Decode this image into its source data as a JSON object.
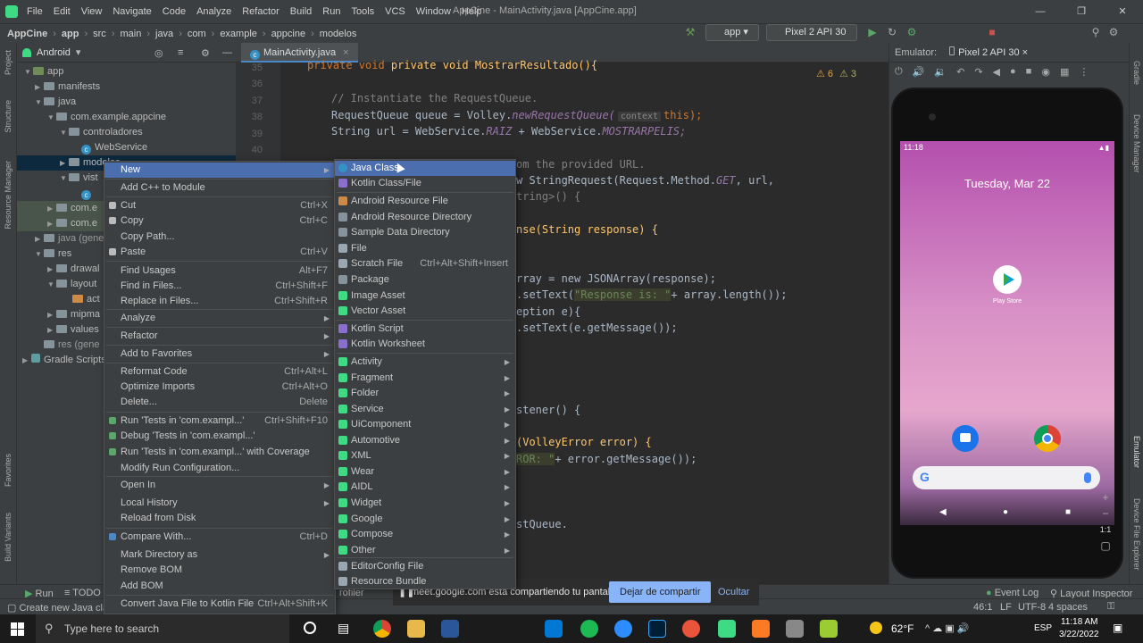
{
  "menubar": {
    "items": [
      "File",
      "Edit",
      "View",
      "Navigate",
      "Code",
      "Analyze",
      "Refactor",
      "Build",
      "Run",
      "Tools",
      "VCS",
      "Window",
      "Help"
    ],
    "title": "AppCine - MainActivity.java [AppCine.app]"
  },
  "breadcrumb": [
    "AppCine",
    "app",
    "src",
    "main",
    "java",
    "com",
    "example",
    "appcine",
    "modelos"
  ],
  "toolbar": {
    "module": "app",
    "device": "Pixel 2 API 30"
  },
  "project": {
    "view": "Android",
    "rows": [
      "app",
      "manifests",
      "java",
      "com.example.appcine",
      "controladores",
      "WebService",
      "modelos",
      "vist",
      "",
      "com.e",
      "com.e",
      "java (gene",
      "res",
      "drawal",
      "layout",
      "act",
      "mipma",
      "values",
      "res (gene",
      "Gradle Scripts"
    ]
  },
  "editor": {
    "tab": "MainActivity.java",
    "warnings": "6",
    "weak": "3",
    "line_numbers": [
      "35",
      "36",
      "37",
      "38",
      "39",
      "40"
    ]
  },
  "code": {
    "l0": "private void MostrarResultado(){",
    "l1": "// Instantiate the RequestQueue.",
    "l2a": "RequestQueue queue = Volley.",
    "l2b": "newRequestQueue(",
    "l2c": "context",
    "l2d": "this);",
    "l3a": "String url = WebService.",
    "l3b": "RAIZ",
    "l3c": " + WebService.",
    "l3d": "MOSTRARPELIS;",
    "l4": "om the provided URL.",
    "l5a": "w StringRequest(Request.Method.",
    "l5b": "GET",
    ", url": "",
    "l5c": ", url,",
    "l6": "tring>() {",
    "l7": "nse(String response) {",
    "l8a": "rray = new JSONArray(response);",
    "l9a": ".setText(",
    "l9b": "\"Response is: \"",
    "l9c": "+ array.length());",
    "l10": "eption e){",
    "l11": ".setText(e.getMessage());",
    "l12": "stener() {",
    "l13": "(VolleyError error) {",
    "l14a": "ROR: \"",
    "l14b": "+ error.getMessage());",
    "l15": "stQueue."
  },
  "ctx_menu": {
    "items": [
      {
        "label": "New",
        "shortcut": "",
        "sub": true
      },
      {
        "label": "Add C++ to Module",
        "shortcut": ""
      },
      {
        "label": "Cut",
        "shortcut": "Ctrl+X"
      },
      {
        "label": "Copy",
        "shortcut": "Ctrl+C"
      },
      {
        "label": "Copy Path...",
        "shortcut": ""
      },
      {
        "label": "Paste",
        "shortcut": "Ctrl+V"
      },
      {
        "label": "Find Usages",
        "shortcut": "Alt+F7"
      },
      {
        "label": "Find in Files...",
        "shortcut": "Ctrl+Shift+F"
      },
      {
        "label": "Replace in Files...",
        "shortcut": "Ctrl+Shift+R"
      },
      {
        "label": "Analyze",
        "shortcut": "",
        "sub": true
      },
      {
        "label": "Refactor",
        "shortcut": "",
        "sub": true
      },
      {
        "label": "Add to Favorites",
        "shortcut": "",
        "sub": true
      },
      {
        "label": "Reformat Code",
        "shortcut": "Ctrl+Alt+L"
      },
      {
        "label": "Optimize Imports",
        "shortcut": "Ctrl+Alt+O"
      },
      {
        "label": "Delete...",
        "shortcut": "Delete"
      },
      {
        "label": "Run 'Tests in 'com.exampl...'",
        "shortcut": "Ctrl+Shift+F10"
      },
      {
        "label": "Debug 'Tests in 'com.exampl...'",
        "shortcut": ""
      },
      {
        "label": "Run 'Tests in 'com.exampl...' with Coverage",
        "shortcut": ""
      },
      {
        "label": "Modify Run Configuration...",
        "shortcut": ""
      },
      {
        "label": "Open In",
        "shortcut": "",
        "sub": true
      },
      {
        "label": "Local History",
        "shortcut": "",
        "sub": true
      },
      {
        "label": "Reload from Disk",
        "shortcut": ""
      },
      {
        "label": "Compare With...",
        "shortcut": "Ctrl+D"
      },
      {
        "label": "Mark Directory as",
        "shortcut": "",
        "sub": true
      },
      {
        "label": "Remove BOM",
        "shortcut": ""
      },
      {
        "label": "Add BOM",
        "shortcut": ""
      },
      {
        "label": "Convert Java File to Kotlin File",
        "shortcut": "Ctrl+Alt+Shift+K"
      }
    ]
  },
  "new_menu": {
    "items": [
      {
        "label": "Java Class",
        "shortcut": "",
        "color": "#3592c4"
      },
      {
        "label": "Kotlin Class/File",
        "shortcut": "",
        "color": "#8a6fcf"
      },
      {
        "label": "Android Resource File",
        "shortcut": "",
        "color": "#d08a48"
      },
      {
        "label": "Android Resource Directory",
        "shortcut": "",
        "color": "#87939a"
      },
      {
        "label": "Sample Data Directory",
        "shortcut": "",
        "color": "#87939a"
      },
      {
        "label": "File",
        "shortcut": "",
        "color": "#9aa7b0"
      },
      {
        "label": "Scratch File",
        "shortcut": "Ctrl+Alt+Shift+Insert",
        "color": "#9aa7b0"
      },
      {
        "label": "Package",
        "shortcut": "",
        "color": "#87939a"
      },
      {
        "label": "Image Asset",
        "shortcut": "",
        "color": "#3ddc84"
      },
      {
        "label": "Vector Asset",
        "shortcut": "",
        "color": "#3ddc84"
      },
      {
        "label": "Kotlin Script",
        "shortcut": "",
        "color": "#8a6fcf"
      },
      {
        "label": "Kotlin Worksheet",
        "shortcut": "",
        "color": "#8a6fcf"
      },
      {
        "label": "Activity",
        "shortcut": "",
        "sub": true,
        "color": "#3ddc84"
      },
      {
        "label": "Fragment",
        "shortcut": "",
        "sub": true,
        "color": "#3ddc84"
      },
      {
        "label": "Folder",
        "shortcut": "",
        "sub": true,
        "color": "#3ddc84"
      },
      {
        "label": "Service",
        "shortcut": "",
        "sub": true,
        "color": "#3ddc84"
      },
      {
        "label": "UiComponent",
        "shortcut": "",
        "sub": true,
        "color": "#3ddc84"
      },
      {
        "label": "Automotive",
        "shortcut": "",
        "sub": true,
        "color": "#3ddc84"
      },
      {
        "label": "XML",
        "shortcut": "",
        "sub": true,
        "color": "#3ddc84"
      },
      {
        "label": "Wear",
        "shortcut": "",
        "sub": true,
        "color": "#3ddc84"
      },
      {
        "label": "AIDL",
        "shortcut": "",
        "sub": true,
        "color": "#3ddc84"
      },
      {
        "label": "Widget",
        "shortcut": "",
        "sub": true,
        "color": "#3ddc84"
      },
      {
        "label": "Google",
        "shortcut": "",
        "sub": true,
        "color": "#3ddc84"
      },
      {
        "label": "Compose",
        "shortcut": "",
        "sub": true,
        "color": "#3ddc84"
      },
      {
        "label": "Other",
        "shortcut": "",
        "sub": true,
        "color": "#3ddc84"
      },
      {
        "label": "EditorConfig File",
        "shortcut": "",
        "color": "#9aa7b0"
      },
      {
        "label": "Resource Bundle",
        "shortcut": "",
        "color": "#9aa7b0"
      }
    ]
  },
  "emulator": {
    "label": "Emulator:",
    "device": "Pixel 2 API 30",
    "time": "11:18",
    "date": "Tuesday, Mar 22",
    "playstore": "Play Store",
    "zoom": "1:1"
  },
  "bottom": {
    "run": "Run",
    "todo": "TODO",
    "profiler": "rofiler",
    "event_log": "Event Log",
    "layout_inspector": "Layout Inspector"
  },
  "share": {
    "text": "meet.google.com está compartiendo tu pantalla.",
    "stop": "Dejar de compartir",
    "hide": "Ocultar"
  },
  "status": {
    "msg": "Create new Java clas",
    "pos": "46:1",
    "lf": "LF",
    "enc": "UTF-8",
    "indent": "4 spaces"
  },
  "side": {
    "project": "Project",
    "structure": "Structure",
    "resource": "Resource Manager",
    "favorites": "Favorites",
    "build_variants": "Build Variants",
    "gradle": "Gradle",
    "device_manager": "Device Manager",
    "emulator": "Emulator",
    "device_file": "Device File Explorer"
  },
  "taskbar": {
    "search": "Type here to search",
    "temp": "62°F",
    "lang": "ESP",
    "time": "11:18 AM",
    "date": "3/22/2022"
  }
}
